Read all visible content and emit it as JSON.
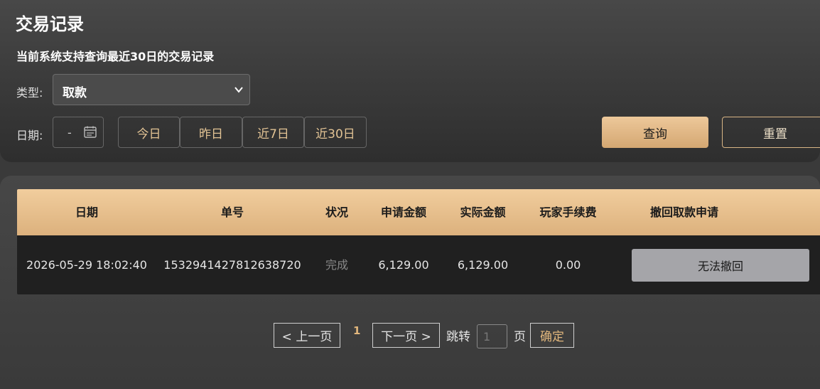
{
  "page": {
    "title": "交易记录",
    "subtitle": "当前系统支持查询最近30日的交易记录"
  },
  "filters": {
    "type_label": "类型:",
    "type_value": "取款",
    "date_label": "日期:",
    "date_value": "-",
    "quick_ranges": [
      "今日",
      "昨日",
      "近7日",
      "近30日"
    ],
    "query_label": "查询",
    "reset_label": "重置"
  },
  "table": {
    "columns": [
      "日期",
      "单号",
      "状况",
      "申请金额",
      "实际金额",
      "玩家手续费",
      "撤回取款申请"
    ],
    "rows": [
      {
        "date": "2026-05-29 18:02:40",
        "order_no": "1532941427812638720",
        "status": "完成",
        "requested_amount": "6,129.00",
        "actual_amount": "6,129.00",
        "fee": "0.00",
        "action_label": "无法撤回"
      }
    ]
  },
  "pagination": {
    "prev_label": "< 上一页",
    "current_page": "1",
    "next_label": "下一页 >",
    "jump_label": "跳转",
    "jump_placeholder": "1",
    "page_unit": "页",
    "confirm_label": "确定"
  },
  "colors": {
    "accent": "#e1b67c",
    "header_bg": "#e8c18e",
    "query_bg": "#dfb583"
  },
  "icons": {
    "dropdown": "chevron-down-icon",
    "date": "calendar-icon"
  }
}
